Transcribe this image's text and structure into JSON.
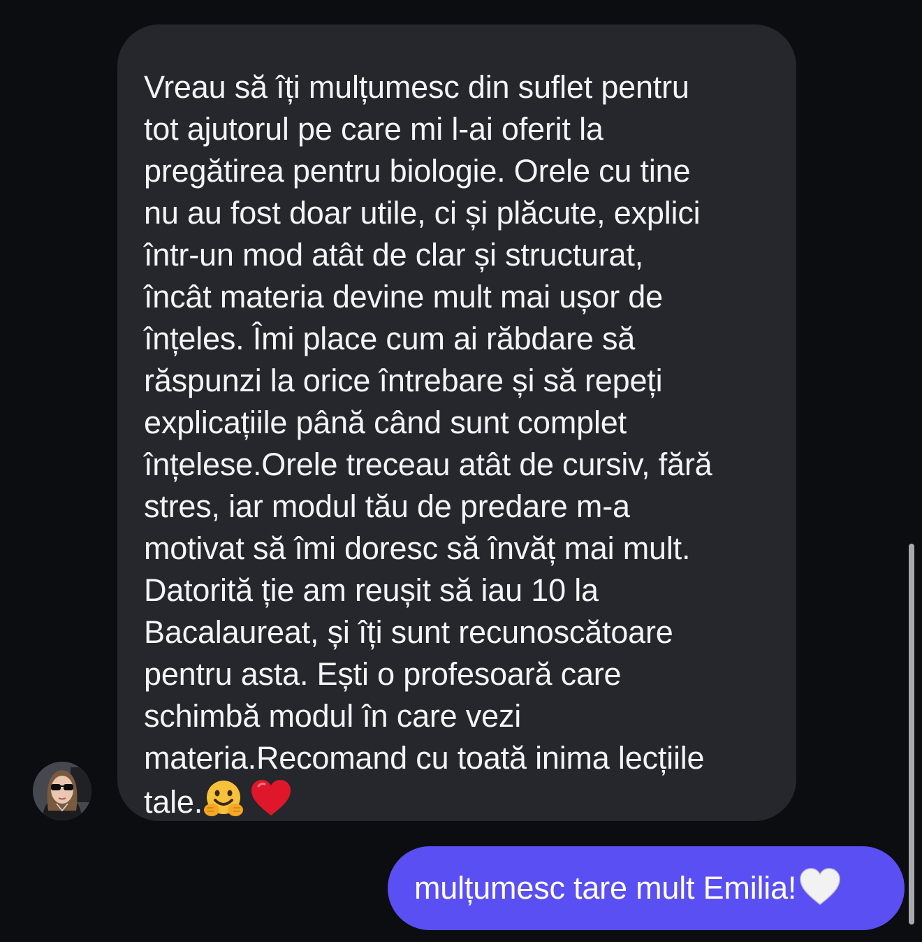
{
  "messages": {
    "incoming": {
      "lines": [
        "Vreau să îți mulțumesc din suflet pentru",
        "tot ajutorul pe care mi l-ai oferit la",
        "pregătirea pentru biologie. Orele cu tine",
        "nu au fost doar utile, ci și plăcute, explici",
        "într-un mod atât de clar și structurat,",
        "încât materia devine mult mai ușor de",
        "înțeles. Îmi place cum ai răbdare să",
        "răspunzi la orice întrebare și să repeți",
        "explicațiile până când sunt complet",
        "înțelese.Orele treceau atât de cursiv, fără",
        "stres, iar modul tău de predare m-a",
        "motivat să îmi doresc să învăț mai mult.",
        "Datorită ție am reușit să iau 10 la",
        "Bacalaureat, și îți sunt recunoscătoare",
        "pentru asta. Ești o profesoară care",
        "schimbă modul în care vezi",
        "materia.Recomand cu toată inima lecțiile"
      ],
      "last_line": "tale.",
      "emojis": [
        "hugging-face",
        "red-heart"
      ]
    },
    "outgoing": {
      "text": "mulțumesc tare mult Emilia!",
      "emoji": "white-heart"
    }
  },
  "colors": {
    "background": "#0b0d10",
    "incoming_bubble": "#25272c",
    "outgoing_bubble": "#5a4ff2",
    "text": "#f4f4f5"
  }
}
